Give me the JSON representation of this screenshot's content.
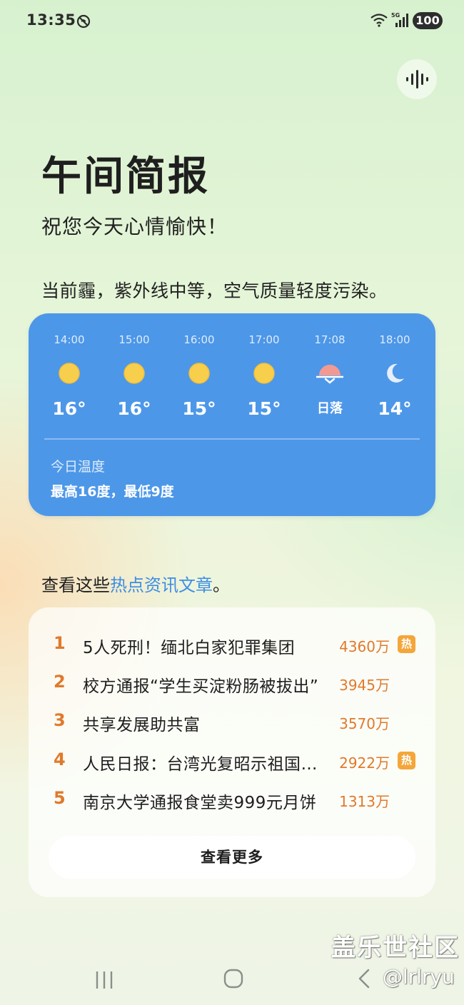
{
  "status_bar": {
    "time": "13:35",
    "battery": "100",
    "icons": [
      "do-not-disturb-icon",
      "wifi-icon",
      "5g-signal-icon"
    ]
  },
  "page": {
    "title": "午间简报",
    "greeting": "祝您今天心情愉快！",
    "weather_summary": "当前霾，紫外线中等，空气质量轻度污染。"
  },
  "weather": {
    "hours": [
      {
        "time": "14:00",
        "icon": "sun-icon",
        "temp": "16°"
      },
      {
        "time": "15:00",
        "icon": "sun-icon",
        "temp": "16°"
      },
      {
        "time": "16:00",
        "icon": "sun-icon",
        "temp": "15°"
      },
      {
        "time": "17:00",
        "icon": "sun-icon",
        "temp": "15°"
      },
      {
        "time": "17:08",
        "icon": "sunset-icon",
        "temp": "日落"
      },
      {
        "time": "18:00",
        "icon": "moon-icon",
        "temp": "14°"
      }
    ],
    "today_label": "今日温度",
    "today_range": "最高16度，最低9度"
  },
  "hot_intro": {
    "prefix": "查看这些",
    "link": "热点资讯文章",
    "suffix": "。"
  },
  "news": {
    "items": [
      {
        "rank": "1",
        "title": "5人死刑！缅北白家犯罪集团",
        "count": "4360万",
        "badge": "热"
      },
      {
        "rank": "2",
        "title": "校方通报“学生买淀粉肠被拔出”",
        "count": "3945万",
        "badge": ""
      },
      {
        "rank": "3",
        "title": "共享发展助共富",
        "count": "3570万",
        "badge": ""
      },
      {
        "rank": "4",
        "title": "人民日报：台湾光复昭示祖国统一",
        "count": "2922万",
        "badge": "热"
      },
      {
        "rank": "5",
        "title": "南京大学通报食堂卖999元月饼",
        "count": "1313万",
        "badge": ""
      }
    ],
    "more_label": "查看更多"
  },
  "watermark": {
    "logo": "盖乐世社区",
    "handle": "@lrlryu"
  },
  "colors": {
    "weather_card": "#4d97e8",
    "rank": "#e07a2c",
    "hot_badge": "#f4a63a",
    "link": "#3c8ee4"
  }
}
